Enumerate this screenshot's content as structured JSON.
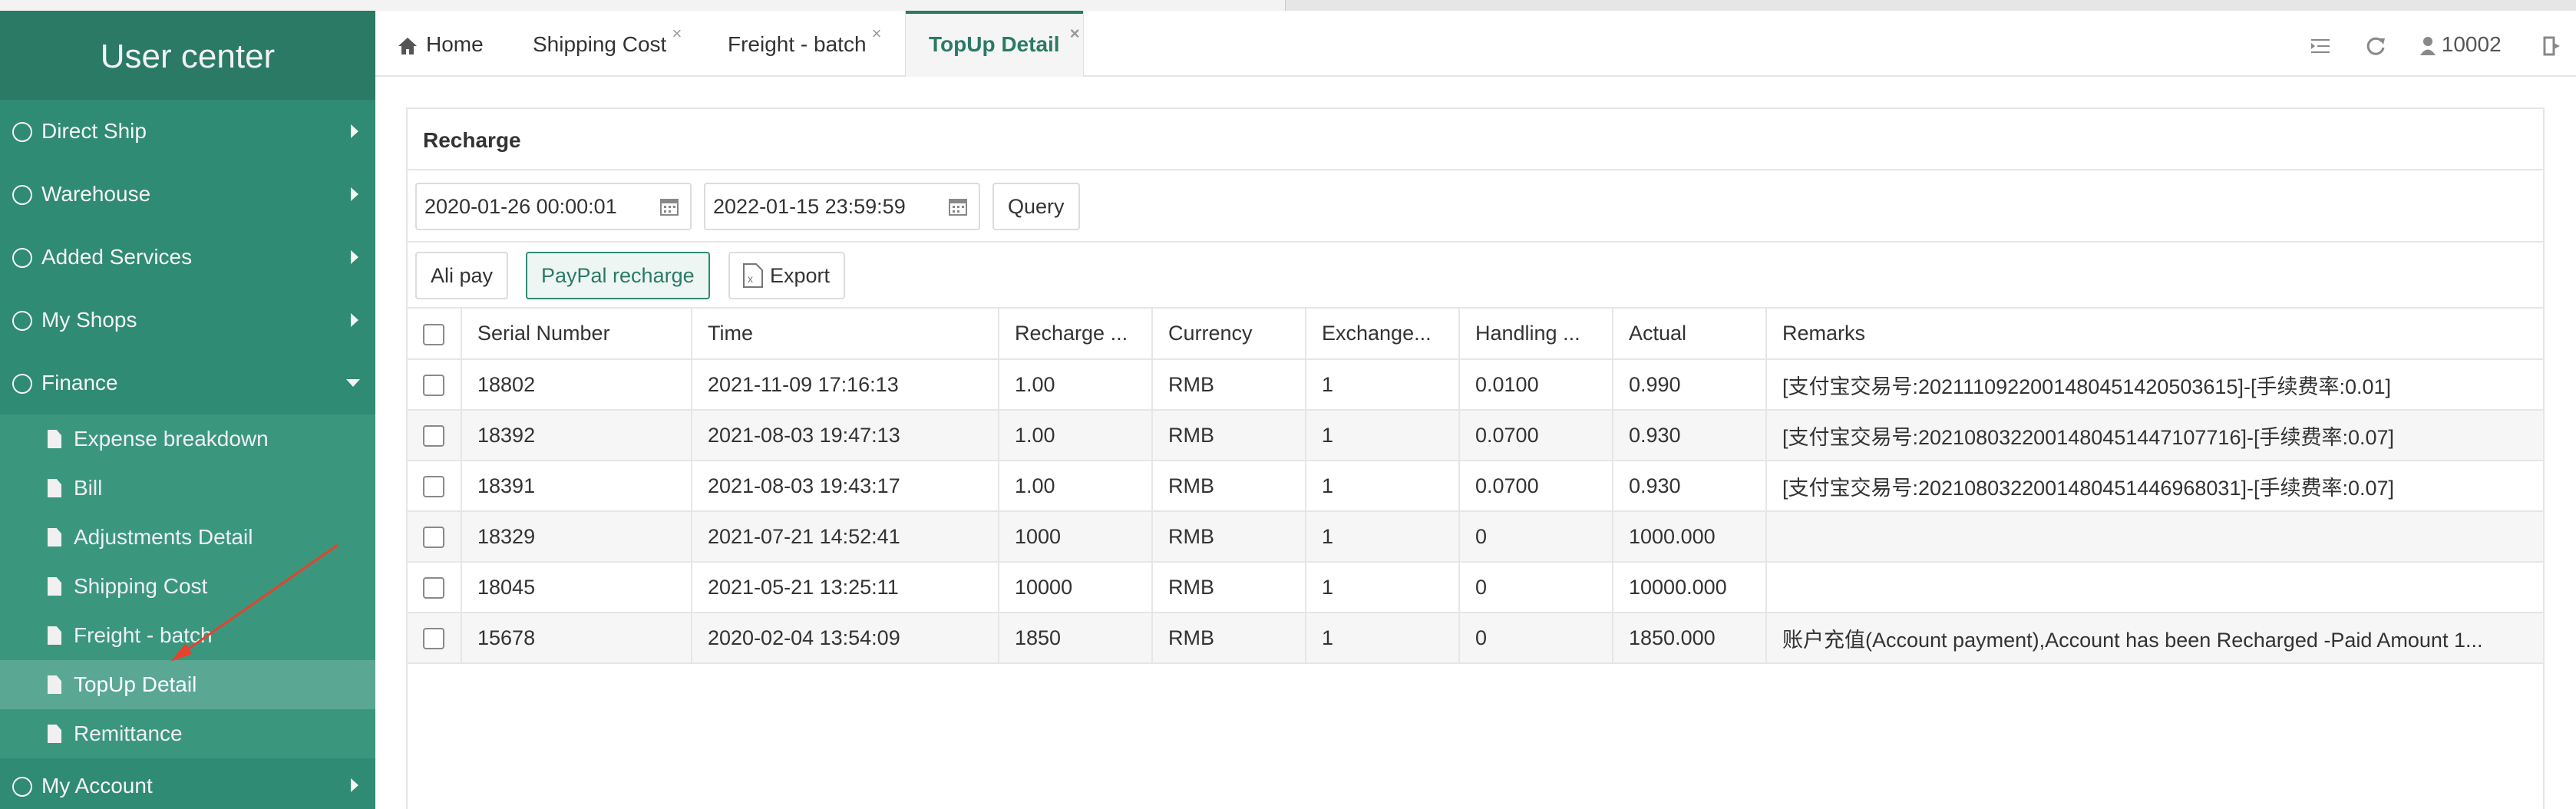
{
  "sidebar": {
    "title": "User center",
    "menu": [
      {
        "label": "Direct Ship"
      },
      {
        "label": "Warehouse"
      },
      {
        "label": "Added Services"
      },
      {
        "label": "My Shops"
      },
      {
        "label": "Finance"
      }
    ],
    "finance_items": [
      {
        "label": "Expense breakdown"
      },
      {
        "label": "Bill"
      },
      {
        "label": "Adjustments Detail"
      },
      {
        "label": "Shipping Cost"
      },
      {
        "label": "Freight - batch"
      },
      {
        "label": "TopUp Detail"
      },
      {
        "label": "Remittance"
      }
    ],
    "bottom_menu": {
      "label": "My Account"
    }
  },
  "tabs": {
    "home": "Home",
    "shipping_cost": "Shipping Cost",
    "freight_batch": "Freight - batch",
    "topup_detail": "TopUp Detail"
  },
  "toolbar": {
    "user_id": "10002"
  },
  "panel": {
    "title": "Recharge",
    "date_start": "2020-01-26 00:00:01",
    "date_end": "2022-01-15 23:59:59",
    "query_label": "Query",
    "alipay_label": "Ali pay",
    "paypal_label": "PayPal recharge",
    "export_label": "Export"
  },
  "table": {
    "headers": [
      "Serial Number",
      "Time",
      "Recharge ...",
      "Currency",
      "Exchange...",
      "Handling ...",
      "Actual",
      "Remarks"
    ],
    "rows": [
      [
        "18802",
        "2021-11-09 17:16:13",
        "1.00",
        "RMB",
        "1",
        "0.0100",
        "0.990",
        "[支付宝交易号:2021110922001480451420503615]-[手续费率:0.01]"
      ],
      [
        "18392",
        "2021-08-03 19:47:13",
        "1.00",
        "RMB",
        "1",
        "0.0700",
        "0.930",
        "[支付宝交易号:2021080322001480451447107716]-[手续费率:0.07]"
      ],
      [
        "18391",
        "2021-08-03 19:43:17",
        "1.00",
        "RMB",
        "1",
        "0.0700",
        "0.930",
        "[支付宝交易号:2021080322001480451446968031]-[手续费率:0.07]"
      ],
      [
        "18329",
        "2021-07-21 14:52:41",
        "1000",
        "RMB",
        "1",
        "0",
        "1000.000",
        ""
      ],
      [
        "18045",
        "2021-05-21 13:25:11",
        "10000",
        "RMB",
        "1",
        "0",
        "10000.000",
        ""
      ],
      [
        "15678",
        "2020-02-04 13:54:09",
        "1850",
        "RMB",
        "1",
        "0",
        "1850.000",
        "账户充值(Account payment),Account has been Recharged -Paid Amount 1..."
      ]
    ]
  },
  "colors": {
    "sidebar": "#2f8b73",
    "accent": "#2a7a65",
    "annotation_arrow": "#e8412c"
  }
}
